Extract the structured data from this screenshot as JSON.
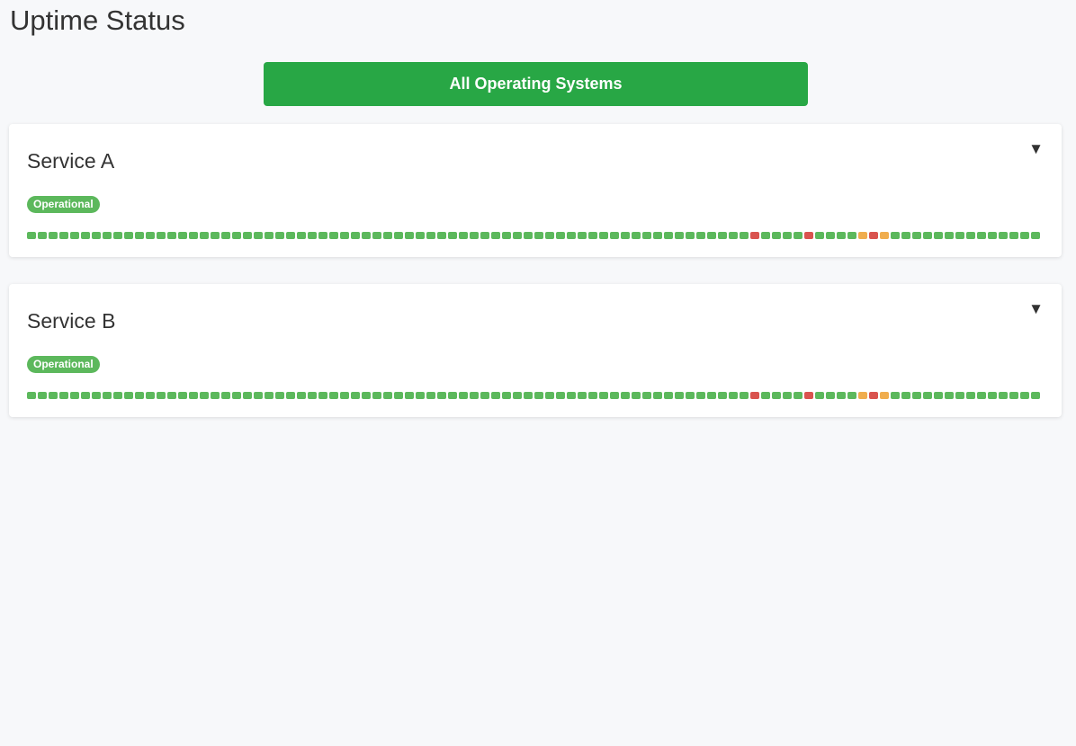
{
  "page": {
    "title": "Uptime Status",
    "overall_status": "All Operating Systems"
  },
  "colors": {
    "operational": "#5cb85c",
    "outage": "#d9534f",
    "degraded": "#f0ad4e",
    "banner": "#28a745"
  },
  "legend_states": [
    "operational",
    "outage",
    "degraded"
  ],
  "services": [
    {
      "name": "Service A",
      "status": "Operational",
      "toggle": "▼",
      "history": [
        "up",
        "up",
        "up",
        "up",
        "up",
        "up",
        "up",
        "up",
        "up",
        "up",
        "up",
        "up",
        "up",
        "up",
        "up",
        "up",
        "up",
        "up",
        "up",
        "up",
        "up",
        "up",
        "up",
        "up",
        "up",
        "up",
        "up",
        "up",
        "up",
        "up",
        "up",
        "up",
        "up",
        "up",
        "up",
        "up",
        "up",
        "up",
        "up",
        "up",
        "up",
        "up",
        "up",
        "up",
        "up",
        "up",
        "up",
        "up",
        "up",
        "up",
        "up",
        "up",
        "up",
        "up",
        "up",
        "up",
        "up",
        "up",
        "up",
        "up",
        "up",
        "up",
        "up",
        "up",
        "up",
        "up",
        "up",
        "down",
        "up",
        "up",
        "up",
        "up",
        "down",
        "up",
        "up",
        "up",
        "up",
        "warn",
        "down",
        "warn",
        "up",
        "up",
        "up",
        "up",
        "up",
        "up",
        "up",
        "up",
        "up",
        "up",
        "up",
        "up",
        "up",
        "up"
      ]
    },
    {
      "name": "Service B",
      "status": "Operational",
      "toggle": "▼",
      "history": [
        "up",
        "up",
        "up",
        "up",
        "up",
        "up",
        "up",
        "up",
        "up",
        "up",
        "up",
        "up",
        "up",
        "up",
        "up",
        "up",
        "up",
        "up",
        "up",
        "up",
        "up",
        "up",
        "up",
        "up",
        "up",
        "up",
        "up",
        "up",
        "up",
        "up",
        "up",
        "up",
        "up",
        "up",
        "up",
        "up",
        "up",
        "up",
        "up",
        "up",
        "up",
        "up",
        "up",
        "up",
        "up",
        "up",
        "up",
        "up",
        "up",
        "up",
        "up",
        "up",
        "up",
        "up",
        "up",
        "up",
        "up",
        "up",
        "up",
        "up",
        "up",
        "up",
        "up",
        "up",
        "up",
        "up",
        "up",
        "down",
        "up",
        "up",
        "up",
        "up",
        "down",
        "up",
        "up",
        "up",
        "up",
        "warn",
        "down",
        "warn",
        "up",
        "up",
        "up",
        "up",
        "up",
        "up",
        "up",
        "up",
        "up",
        "up",
        "up",
        "up",
        "up",
        "up"
      ]
    }
  ]
}
